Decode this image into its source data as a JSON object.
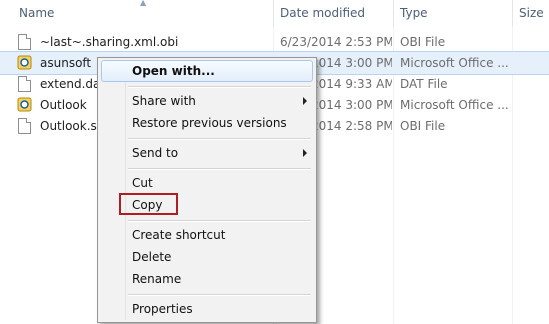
{
  "columns": {
    "name": "Name",
    "date_modified": "Date modified",
    "type": "Type",
    "size": "Size"
  },
  "files": [
    {
      "name": "~last~.sharing.xml.obi",
      "date": "6/23/2014 2:53 PM",
      "type": "OBI File",
      "icon": "file-icon",
      "selected": false
    },
    {
      "name": "asunsoft",
      "date": "6/23/2014 3:00 PM",
      "type": "Microsoft Office ...",
      "icon": "outlook-data-icon",
      "selected": true
    },
    {
      "name": "extend.dat",
      "date": "6/24/2014 9:33 AM",
      "type": "DAT File",
      "icon": "file-icon",
      "selected": false
    },
    {
      "name": "Outlook",
      "date": "6/23/2014 3:00 PM",
      "type": "Microsoft Office ...",
      "icon": "outlook-data-icon",
      "selected": false
    },
    {
      "name": "Outlook.sh",
      "date": "6/23/2014 2:58 PM",
      "type": "OBI File",
      "icon": "file-icon",
      "selected": false
    }
  ],
  "context_menu": {
    "open_with": "Open with...",
    "share_with": "Share with",
    "restore_previous_versions": "Restore previous versions",
    "send_to": "Send to",
    "cut": "Cut",
    "copy": "Copy",
    "create_shortcut": "Create shortcut",
    "delete": "Delete",
    "rename": "Rename",
    "properties": "Properties"
  },
  "colors": {
    "selection": "#e5f0fb",
    "highlight_border": "#b01e23",
    "header_text": "#4c607a"
  }
}
